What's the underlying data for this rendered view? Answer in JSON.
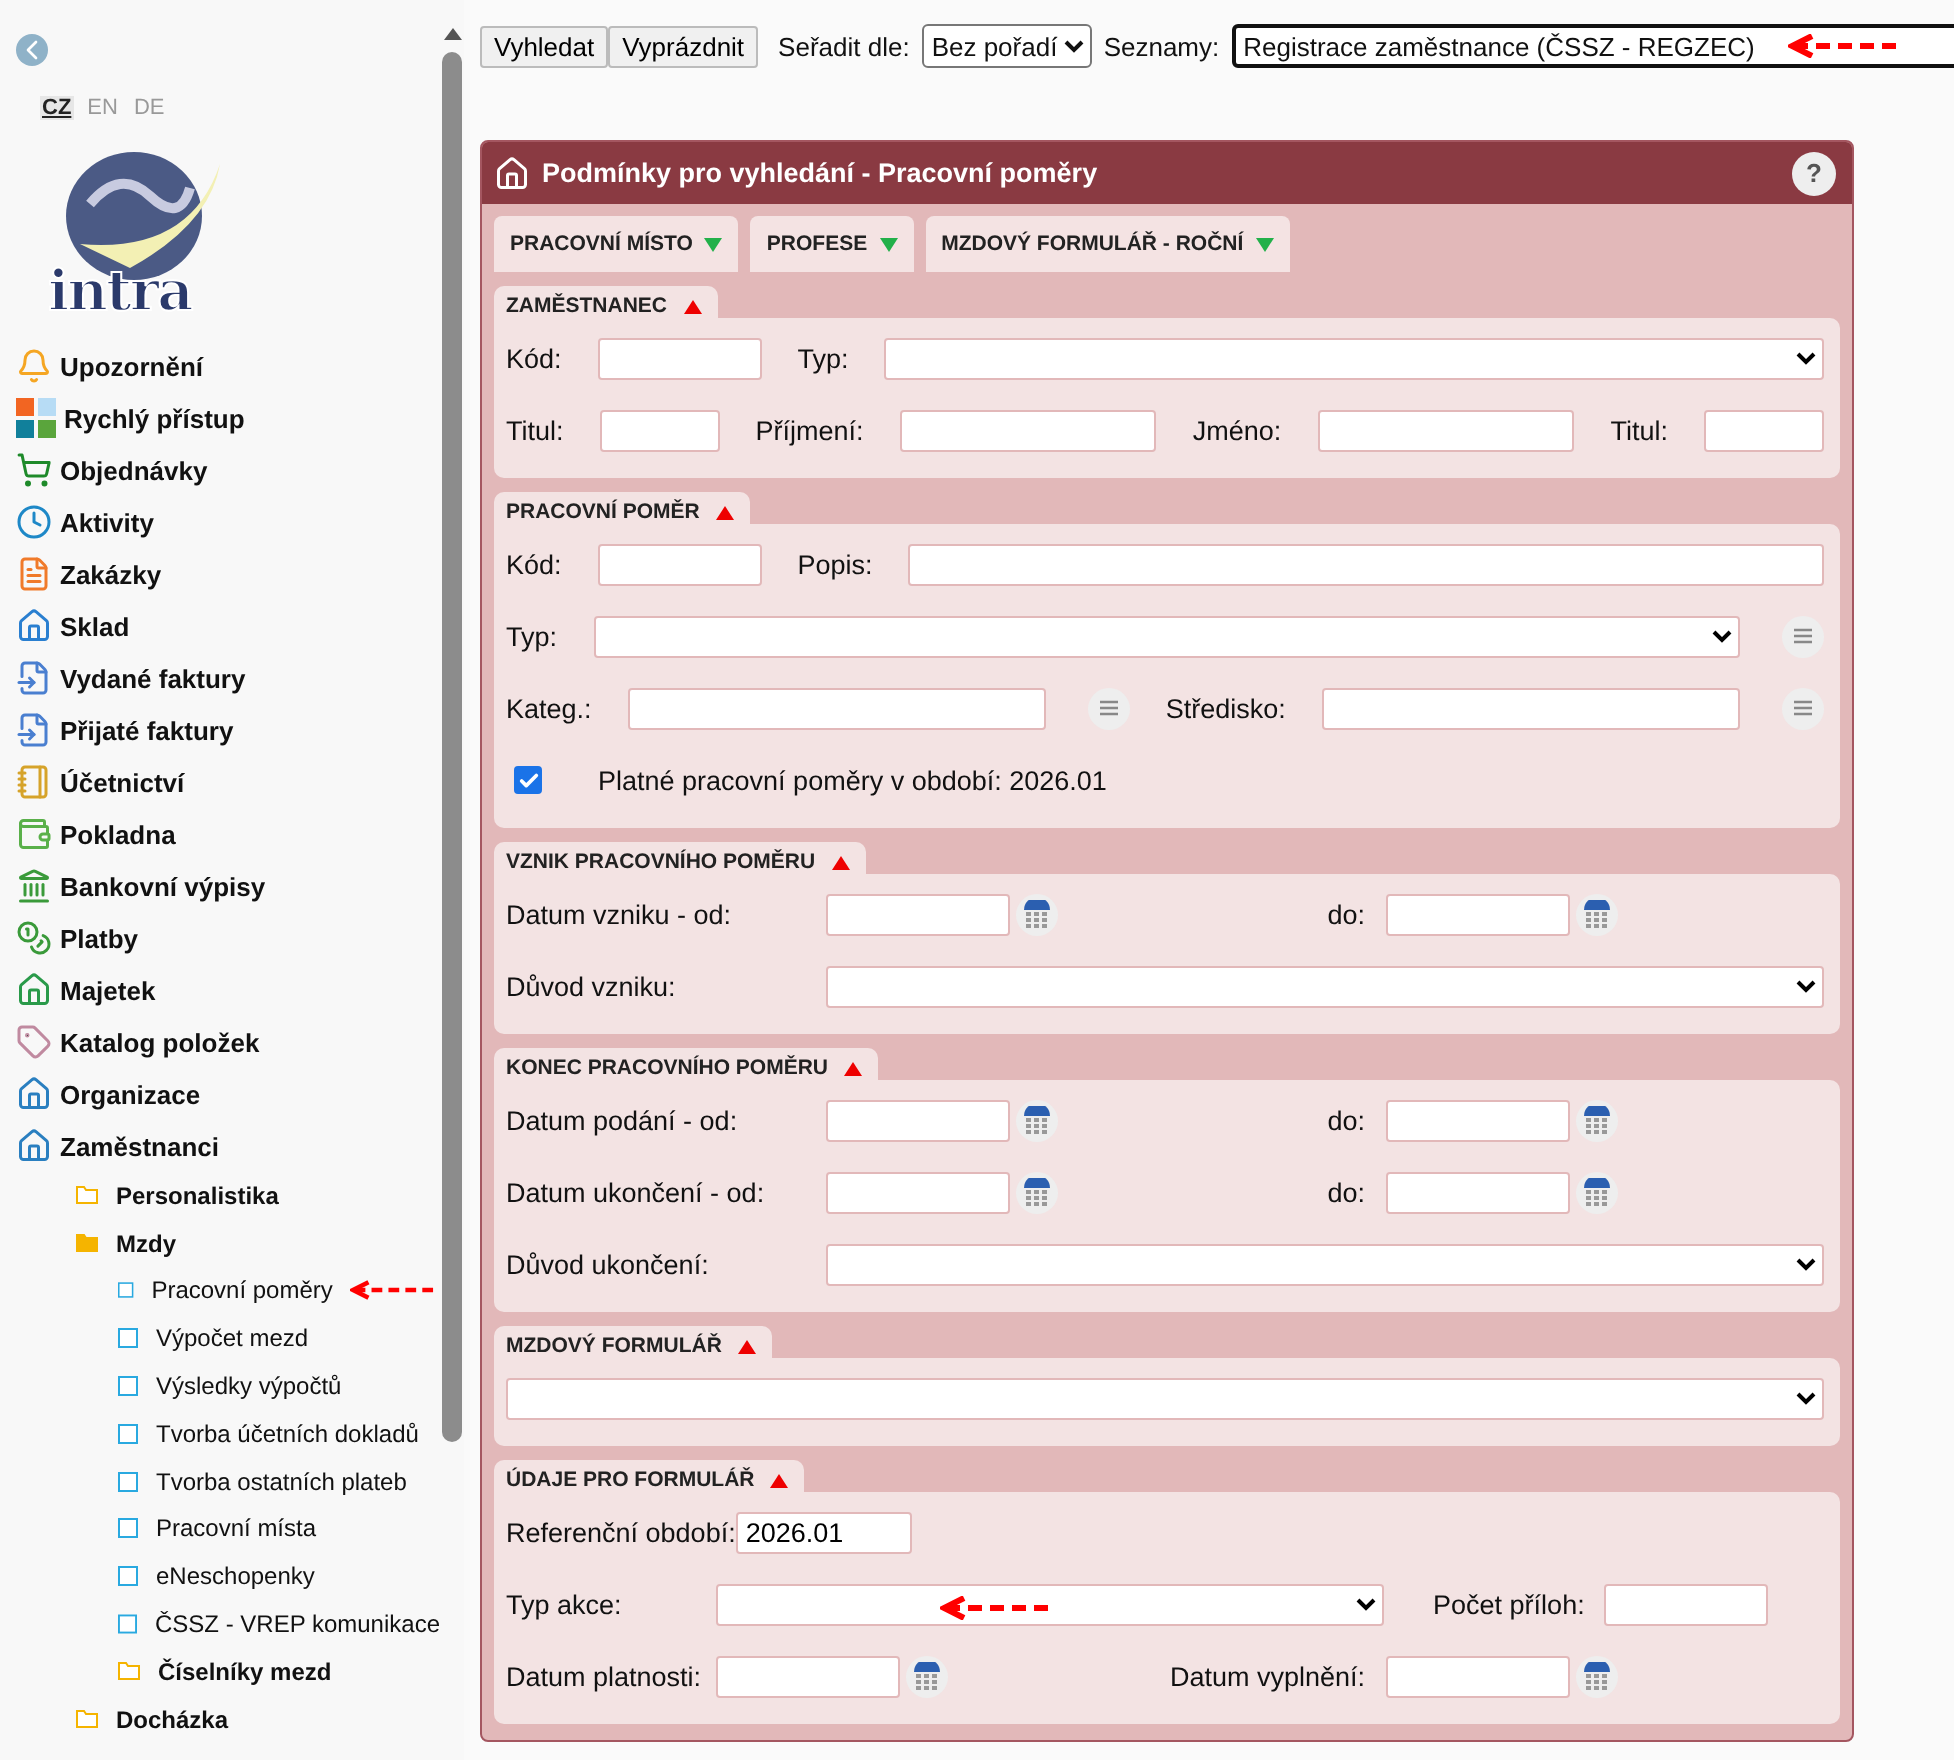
{
  "sidebar": {
    "languages": [
      {
        "label": "CZ",
        "selected": true
      },
      {
        "label": "EN",
        "selected": false
      },
      {
        "label": "DE",
        "selected": false
      }
    ],
    "logo": "intra",
    "items": [
      {
        "label": "Upozornění"
      },
      {
        "label": "Rychlý přístup"
      },
      {
        "label": "Objednávky"
      },
      {
        "label": "Aktivity"
      },
      {
        "label": "Zakázky"
      },
      {
        "label": "Sklad"
      },
      {
        "label": "Vydané faktury"
      },
      {
        "label": "Přijaté faktury"
      },
      {
        "label": "Účetnictví"
      },
      {
        "label": "Pokladna"
      },
      {
        "label": "Bankovní výpisy"
      },
      {
        "label": "Platby"
      },
      {
        "label": "Majetek"
      },
      {
        "label": "Katalog položek"
      },
      {
        "label": "Organizace"
      },
      {
        "label": "Zaměstnanci",
        "children": [
          {
            "label": "Personalistika",
            "kind": "folder",
            "expanded": false
          },
          {
            "label": "Mzdy",
            "kind": "folder",
            "expanded": true,
            "children": [
              {
                "label": "Pracovní poměry",
                "kind": "page"
              },
              {
                "label": "Výpočet mezd",
                "kind": "page"
              },
              {
                "label": "Výsledky výpočtů",
                "kind": "page"
              },
              {
                "label": "Tvorba účetních dokladů",
                "kind": "page"
              },
              {
                "label": "Tvorba ostatních plateb",
                "kind": "page"
              },
              {
                "label": "Pracovní místa",
                "kind": "page"
              },
              {
                "label": "eNeschopenky",
                "kind": "page"
              },
              {
                "label": "ČSSZ - VREP komunikace",
                "kind": "page"
              },
              {
                "label": "Číselníky mezd",
                "kind": "folder",
                "expanded": false
              }
            ]
          },
          {
            "label": "Docházka",
            "kind": "folder",
            "expanded": false
          }
        ]
      }
    ]
  },
  "toolbar": {
    "buttons": [
      "Vyhledat",
      "Vyprázdnit"
    ],
    "sort": {
      "label": "Seřadit dle:",
      "value": "Bez pořadí"
    },
    "lists": {
      "label": "Seznamy:",
      "value": "Registrace zaměstnance (ČSSZ - REGZEC)"
    }
  },
  "panel": {
    "title": "Podmínky pro vyhledání - Pracovní poměry",
    "help": "?",
    "tabs": [
      {
        "label": "PRACOVNÍ MÍSTO"
      },
      {
        "label": "PROFESE"
      },
      {
        "label": "MZDOVÝ FORMULÁŘ - ROČNÍ"
      }
    ],
    "sections": [
      {
        "title": "ZAMĚSTNANEC",
        "expanded": true,
        "rows": [
          [
            {
              "kind": "label",
              "text": "Kód:"
            },
            {
              "kind": "code"
            },
            {
              "kind": "label",
              "text": "Typ:"
            },
            {
              "kind": "select"
            }
          ],
          [
            {
              "kind": "label",
              "text": "Titul:"
            },
            {
              "kind": "short"
            },
            {
              "kind": "label",
              "text": "Příjmení:"
            },
            {
              "kind": "medium"
            },
            {
              "kind": "label",
              "text": "Jméno:"
            },
            {
              "kind": "medium"
            },
            {
              "kind": "label",
              "text": "Titul:"
            },
            {
              "kind": "short"
            }
          ]
        ]
      },
      {
        "title": "PRACOVNÍ POMĚR",
        "expanded": true,
        "rows": [
          [
            {
              "kind": "label",
              "text": "Kód:"
            },
            {
              "kind": "code"
            },
            {
              "kind": "label",
              "text": "Popis:"
            },
            {
              "kind": "medium"
            }
          ],
          [
            {
              "kind": "label",
              "text": "Typ:"
            },
            {
              "kind": "select-list"
            }
          ],
          [
            {
              "kind": "label",
              "text": "Kateg.:"
            },
            {
              "kind": "text-list"
            },
            {
              "kind": "label",
              "text": "Středisko:"
            },
            {
              "kind": "text-list"
            }
          ],
          [
            {
              "kind": "checkbox",
              "text": "Platné pracovní poměry v období: 2026.01",
              "checked": true
            }
          ]
        ]
      },
      {
        "title": "VZNIK PRACOVNÍHO POMĚRU",
        "expanded": true,
        "rows": [
          [
            {
              "kind": "label",
              "text": "Datum vzniku - od:"
            },
            {
              "kind": "date"
            },
            {
              "kind": "label",
              "text": "do:"
            },
            {
              "kind": "date"
            }
          ],
          [
            {
              "kind": "label",
              "text": "Důvod vzniku:"
            },
            {
              "kind": "select"
            }
          ]
        ]
      },
      {
        "title": "KONEC PRACOVNÍHO POMĚRU",
        "expanded": true,
        "rows": [
          [
            {
              "kind": "label",
              "text": "Datum podání - od:"
            },
            {
              "kind": "date"
            },
            {
              "kind": "label",
              "text": "do:"
            },
            {
              "kind": "date"
            }
          ],
          [
            {
              "kind": "label",
              "text": "Datum ukončení - od:"
            },
            {
              "kind": "date"
            },
            {
              "kind": "label",
              "text": "do:"
            },
            {
              "kind": "date"
            }
          ],
          [
            {
              "kind": "label",
              "text": "Důvod ukončení:"
            },
            {
              "kind": "select"
            }
          ]
        ]
      },
      {
        "title": "MZDOVÝ FORMULÁŘ",
        "expanded": true,
        "rows": [
          [
            {
              "kind": "select"
            }
          ]
        ]
      },
      {
        "title": "ÚDAJE PRO FORMULÁŘ",
        "expanded": true,
        "rows": [
          [
            {
              "kind": "label",
              "text": "Referenční období:"
            },
            {
              "kind": "code",
              "value": "2026.01"
            }
          ],
          [
            {
              "kind": "label",
              "text": "Typ akce:"
            },
            {
              "kind": "select"
            },
            {
              "kind": "label",
              "text": "Počet příloh:"
            },
            {
              "kind": "code"
            }
          ],
          [
            {
              "kind": "label",
              "text": "Datum platnosti:"
            },
            {
              "kind": "date"
            },
            {
              "kind": "label",
              "text": "Datum vyplnění:"
            },
            {
              "kind": "date"
            }
          ]
        ]
      }
    ]
  }
}
